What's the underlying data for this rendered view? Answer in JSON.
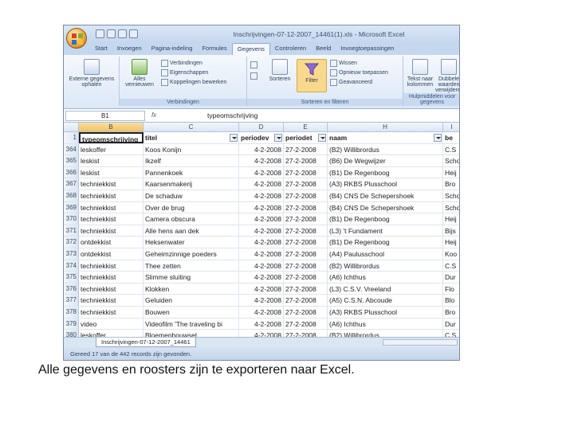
{
  "window": {
    "title": "Inschrijvingen-07-12-2007_14461(1).xls - Microsoft Excel"
  },
  "ribbon_tabs": [
    "Start",
    "Invoegen",
    "Pagina-indeling",
    "Formules",
    "Gegevens",
    "Controleren",
    "Beeld",
    "Invoegtoepassingen"
  ],
  "active_tab_index": 4,
  "ribbon": {
    "external_data_label": "Externe gegevens ophalen",
    "refresh_all_label": "Alles vernieuwen",
    "connections": [
      "Verbindingen",
      "Eigenschappen",
      "Koppelingen bewerken"
    ],
    "group_connections": "Verbindingen",
    "sort_label": "Sorteren",
    "filter_label": "Filter",
    "filter_options": [
      "Wissen",
      "Opnieuw toepassen",
      "Geavanceerd"
    ],
    "group_sort_filter": "Sorteren en filteren",
    "text_to_columns_label": "Tekst naar kolommen",
    "remove_duplicates_label": "Dubbele waarden verwijderen",
    "group_data_tools": "Hulpmiddelen voor gegevens"
  },
  "formula_bar": {
    "name_box": "B1",
    "fx": "fx",
    "content": "typeomschrijving"
  },
  "columns": [
    "B",
    "C",
    "D",
    "E",
    "H",
    "I"
  ],
  "header_row": {
    "num": "1",
    "cells": [
      "typeomschrijving",
      "titel",
      "periodev",
      "periodet",
      "naam",
      "be"
    ]
  },
  "rows": [
    {
      "num": "364",
      "cells": [
        "leskoffer",
        "Koos Konijn",
        "4-2-2008",
        "27-2-2008",
        "(B2) Willibrordus",
        "C.S"
      ]
    },
    {
      "num": "365",
      "cells": [
        "leskist",
        "Ikzelf",
        "4-2-2008",
        "27-2-2008",
        "(B6) De Wegwijzer",
        "Scho"
      ]
    },
    {
      "num": "366",
      "cells": [
        "leskist",
        "Pannenkoek",
        "4-2-2008",
        "27-2-2008",
        "(B1) De Regenboog",
        "Heij"
      ]
    },
    {
      "num": "367",
      "cells": [
        "techniekkist",
        "Kaarsenmakerij",
        "4-2-2008",
        "27-2-2008",
        "(A3) RKBS Plusschool",
        "Bro"
      ]
    },
    {
      "num": "368",
      "cells": [
        "techniekkist",
        "De schaduw",
        "4-2-2008",
        "27-2-2008",
        "(B4) CNS De Schepershoek",
        "Scho"
      ]
    },
    {
      "num": "369",
      "cells": [
        "techniekkist",
        "Over de brug",
        "4-2-2008",
        "27-2-2008",
        "(B4) CNS De Schepershoek",
        "Scho"
      ]
    },
    {
      "num": "370",
      "cells": [
        "techniekkist",
        "Camera obscura",
        "4-2-2008",
        "27-2-2008",
        "(B1) De Regenboog",
        "Heij"
      ]
    },
    {
      "num": "371",
      "cells": [
        "techniekkist",
        "Alle hens aan dek",
        "4-2-2008",
        "27-2-2008",
        "(L3) 't Fundament",
        "Bijs"
      ]
    },
    {
      "num": "372",
      "cells": [
        "ontdekkist",
        "Heksenwater",
        "4-2-2008",
        "27-2-2008",
        "(B1) De Regenboog",
        "Heij"
      ]
    },
    {
      "num": "373",
      "cells": [
        "ontdekkist",
        "Geheimzinnige poeders",
        "4-2-2008",
        "27-2-2008",
        "(A4) Paulusschool",
        "Koo"
      ]
    },
    {
      "num": "374",
      "cells": [
        "techniekkist",
        "Thee zetten",
        "4-2-2008",
        "27-2-2008",
        "(B2) Willibrordus",
        "C.S"
      ]
    },
    {
      "num": "375",
      "cells": [
        "techniekkist",
        "Slimme sluiting",
        "4-2-2008",
        "27-2-2008",
        "(A6) Ichthus",
        "Dur"
      ]
    },
    {
      "num": "376",
      "cells": [
        "techniekkist",
        "Klokken",
        "4-2-2008",
        "27-2-2008",
        "(L3) C.S.V. Vreeland",
        "Flo"
      ]
    },
    {
      "num": "377",
      "cells": [
        "techniekkist",
        "Geluiden",
        "4-2-2008",
        "27-2-2008",
        "(A5) C.S.N. Abcoude",
        "Blo"
      ]
    },
    {
      "num": "378",
      "cells": [
        "techniekkist",
        "Bouwen",
        "4-2-2008",
        "27-2-2008",
        "(A3) RKBS Plusschool",
        "Bro"
      ]
    },
    {
      "num": "379",
      "cells": [
        "video",
        "Videofilm 'The traveling bi",
        "4-2-2008",
        "27-2-2008",
        "(A6) Ichthus",
        "Dur"
      ]
    },
    {
      "num": "380",
      "cells": [
        "leskoffer",
        "Bloemenbouwset",
        "4-2-2008",
        "27-2-2008",
        "(B2) Willibrordus",
        "C.S"
      ]
    }
  ],
  "sheet_tab": "Inschrijvingen-07-12-2007_14461",
  "status_bar": "Gereed    17 van de 442 records zijn gevonden.",
  "caption": "Alle gegevens en roosters zijn te exporteren naar Excel."
}
